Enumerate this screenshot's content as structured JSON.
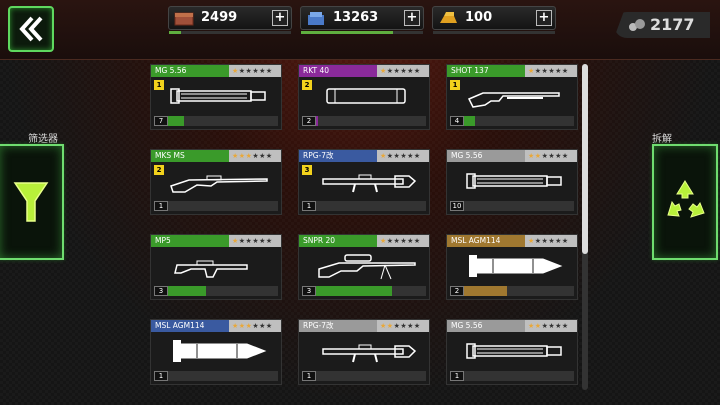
{
  "resources": [
    {
      "name": "supply-crate",
      "value": "2499",
      "color": "#b05a3a",
      "progress": 0.1
    },
    {
      "name": "steel",
      "value": "13263",
      "color": "#5a8ad8",
      "progress": 0.75
    },
    {
      "name": "gold-bars",
      "value": "100",
      "color": "#e0a020",
      "progress": 0.0
    }
  ],
  "plus_label": "+",
  "gems": "2177",
  "filter_label": "筛选器",
  "disassemble_label": "拆解",
  "rarity_colors": {
    "green": "#3a9a2a",
    "purple": "#8a2a9a",
    "blue": "#3a5aa0",
    "white": "#9a9a9a",
    "gold": "#a07830"
  },
  "weapons": [
    {
      "name": "MG 5.56",
      "rarity": "green",
      "stars": 1,
      "level": "1",
      "count": "7",
      "progress": 0.15,
      "gun": "minigun"
    },
    {
      "name": "RKT 40",
      "rarity": "purple",
      "stars": 1,
      "level": "2",
      "count": "2",
      "progress": 0.02,
      "gun": "rocket"
    },
    {
      "name": "SHOT 137",
      "rarity": "green",
      "stars": 1,
      "level": "1",
      "count": "4",
      "progress": 0.1,
      "gun": "shotgun"
    },
    {
      "name": "MKS MS",
      "rarity": "green",
      "stars": 3,
      "level": "2",
      "count": "1",
      "progress": 0.0,
      "gun": "rifle"
    },
    {
      "name": "RPG-7改",
      "rarity": "blue",
      "stars": 1,
      "level": "3",
      "count": "1",
      "progress": 0.0,
      "gun": "rpg"
    },
    {
      "name": "MG 5.56",
      "rarity": "white",
      "stars": 2,
      "level": "",
      "count": "10",
      "progress": 0.0,
      "gun": "minigun"
    },
    {
      "name": "MP5",
      "rarity": "green",
      "stars": 1,
      "level": "",
      "count": "3",
      "progress": 0.35,
      "gun": "smg"
    },
    {
      "name": "SNPR 20",
      "rarity": "green",
      "stars": 1,
      "level": "",
      "count": "3",
      "progress": 0.7,
      "gun": "sniper"
    },
    {
      "name": "MSL AGM114",
      "rarity": "gold",
      "stars": 1,
      "level": "",
      "count": "2",
      "progress": 0.4,
      "gun": "missile"
    },
    {
      "name": "MSL AGM114",
      "rarity": "blue",
      "stars": 3,
      "level": "",
      "count": "1",
      "progress": 0.0,
      "gun": "missile"
    },
    {
      "name": "RPG-7改",
      "rarity": "white",
      "stars": 2,
      "level": "",
      "count": "1",
      "progress": 0.0,
      "gun": "rpg"
    },
    {
      "name": "MG 5.56",
      "rarity": "white",
      "stars": 2,
      "level": "",
      "count": "1",
      "progress": 0.0,
      "gun": "minigun"
    }
  ]
}
